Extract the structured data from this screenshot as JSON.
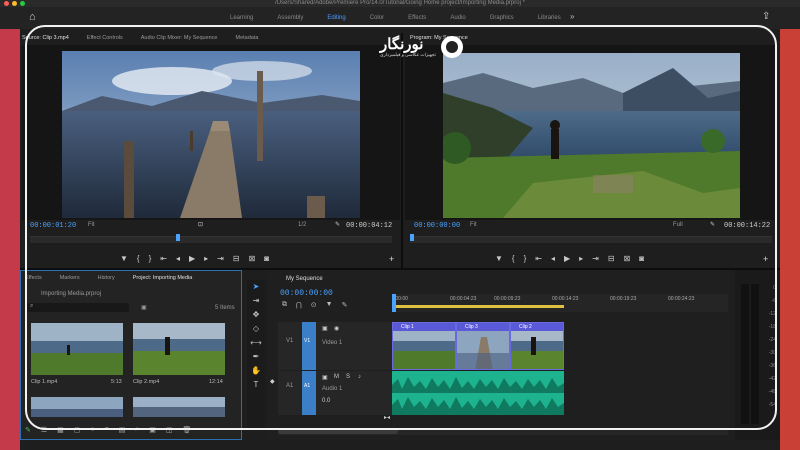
{
  "window": {
    "title": "/Users/Shared/Adobe/Premiere Pro/14.0/Tutorial/Going Home project/Importing Media.prproj *"
  },
  "workspaces": [
    "Learning",
    "Assembly",
    "Editing",
    "Color",
    "Effects",
    "Audio",
    "Graphics",
    "Libraries"
  ],
  "workspace_active": "Editing",
  "source": {
    "tabs": [
      "Source: Clip 3.mp4",
      "Effect Controls",
      "Audio Clip Mixer: My Sequence",
      "Metadata"
    ],
    "timecode": "00:00:01:20",
    "fit": "Fit",
    "resolution": "1/2",
    "duration": "00:00:04:12"
  },
  "program": {
    "tab": "Program: My Sequence",
    "timecode": "00:00:00:00",
    "fit": "Fit",
    "quality": "Full",
    "duration": "00:00:14:22"
  },
  "project": {
    "tabs": [
      "Effects",
      "Markers",
      "History",
      "Project: Importing Media"
    ],
    "filename": "Importing Media.prproj",
    "item_count": "5 Items",
    "clips": [
      {
        "name": "Clip 1.mp4",
        "duration": "5:13"
      },
      {
        "name": "Clip 2.mp4",
        "duration": "12:14"
      }
    ]
  },
  "sequence": {
    "tab": "My Sequence",
    "timecode": "00:00:00:00",
    "ruler": [
      ":00:00",
      "00:00:04:23",
      "00:00:09:23",
      "00:00:14:23",
      "00:00:19:23",
      "00:00:24:23"
    ],
    "v1_label": "V1",
    "v1_name": "Video 1",
    "a1_label": "A1",
    "a1_name": "Audio 1",
    "a1_volume": "0.0",
    "clips": [
      "Clip 1",
      "Clip 3",
      "Clip 2"
    ]
  },
  "meters": [
    "0",
    "-6",
    "-12",
    "-18",
    "-24",
    "-30",
    "-36",
    "-42",
    "-48",
    "-54"
  ],
  "logo": {
    "name": "نورنگار",
    "tagline": "تجهیزات عکاسی و فیلمبرداری"
  }
}
